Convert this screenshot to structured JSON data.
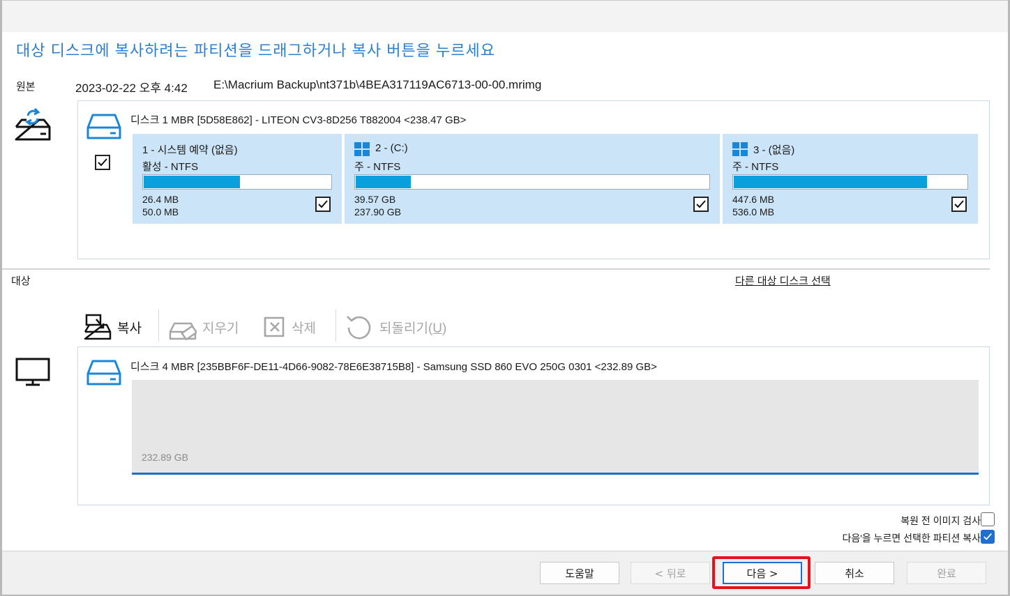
{
  "heading": "대상 디스크에 복사하려는 파티션을 드래그하거나 복사 버튼을 누르세요",
  "source": {
    "label": "원본",
    "date": "2023-02-22 오후 4:42",
    "path": "E:\\Macrium Backup\\nt371b\\4BEA317119AC6713-00-00.mrimg",
    "disk_title": "디스크 1 MBR [5D58E862] - LITEON CV3-8D256 T882004  <238.47 GB>",
    "disk_checked": true,
    "partitions": [
      {
        "name": "1 - 시스템 예약 (없음)",
        "type": "활성 - NTFS",
        "used": "26.4 MB",
        "total": "50.0 MB",
        "fill_fraction": 0.52,
        "checked": true,
        "windows_logo": false
      },
      {
        "name": "2 -  (C:)",
        "type": "주 - NTFS",
        "used": "39.57 GB",
        "total": "237.90 GB",
        "fill_fraction": 0.16,
        "checked": true,
        "windows_logo": true
      },
      {
        "name": "3 -  (없음)",
        "type": "주 - NTFS",
        "used": "447.6 MB",
        "total": "536.0 MB",
        "fill_fraction": 0.83,
        "checked": true,
        "windows_logo": true
      }
    ]
  },
  "target": {
    "label": "대상",
    "other_disk_link": "다른 대상 디스크 선택",
    "toolbar": {
      "copy": "복사",
      "erase": "지우기",
      "delete": "삭제",
      "undo_prefix": "되돌리기(",
      "undo_key": "U",
      "undo_suffix": ")"
    },
    "disk_title": "디스크 4 MBR [235BBF6F-DE11-4D66-9082-78E6E38715B8] - Samsung  SSD 860 EVO 250G 0301  <232.89 GB>",
    "unallocated_size": "232.89 GB"
  },
  "options": {
    "verify_label": "복원 전 이미지 검사",
    "verify_checked": false,
    "copy_selected_label": "다음'을 누르면 선택한 파티션 복사",
    "copy_selected_checked": true
  },
  "buttons": {
    "help": "도움말",
    "back": "< 뒤로",
    "next": "다음 >",
    "cancel": "취소",
    "finish": "완료"
  },
  "colors": {
    "accent": "#2a7fd0",
    "bar_fill": "#0aa0dd",
    "partition_bg": "#cce4f7",
    "highlight": "#e8101a"
  }
}
